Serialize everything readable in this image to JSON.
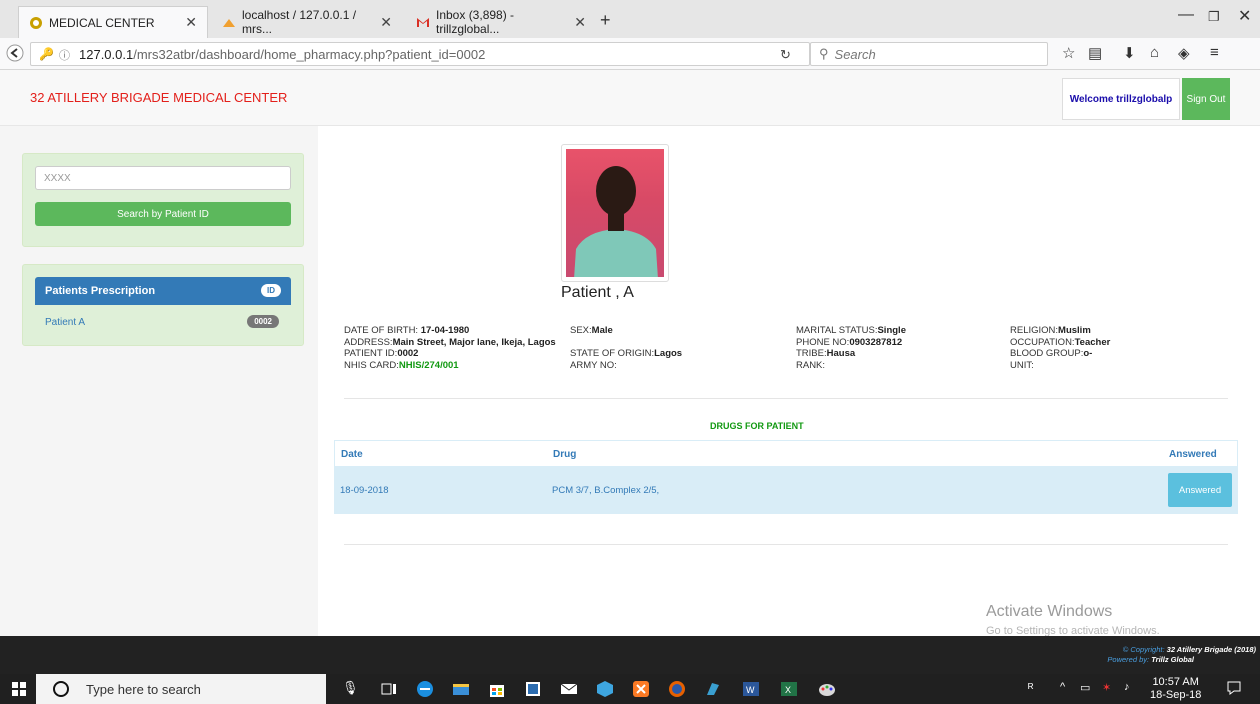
{
  "browser": {
    "tabs": [
      {
        "label": "MEDICAL CENTER",
        "active": true
      },
      {
        "label": "localhost / 127.0.0.1 / mrs...",
        "active": false
      },
      {
        "label": "Inbox (3,898) - trillzglobal...",
        "active": false
      }
    ],
    "url_host": "127.0.0.1",
    "url_path": "/mrs32atbr/dashboard/home_pharmacy.php?patient_id=0002",
    "search_placeholder": "Search"
  },
  "header": {
    "brand": "32 ATILLERY BRIGADE MEDICAL CENTER",
    "welcome": "Welcome trillzglobalp",
    "signout": "Sign Out"
  },
  "sidebar": {
    "search_placeholder": "XXXX",
    "search_button": "Search by Patient ID",
    "prescription_title": "Patients Prescription",
    "prescription_badge": "ID",
    "patients": [
      {
        "name": "Patient A",
        "id": "0002"
      }
    ]
  },
  "patient": {
    "name": "Patient , A",
    "dob_label": "DATE OF BIRTH: ",
    "dob": "17-04-1980",
    "sex_label": "SEX:",
    "sex": "Male",
    "marital_label": "MARITAL STATUS:",
    "marital": "Single",
    "religion_label": "RELIGION:",
    "religion": "Muslim",
    "address_label": "ADDRESS:",
    "address": "Main Street, Major lane, Ikeja, Lagos",
    "phone_label": "PHONE NO:",
    "phone": "0903287812",
    "occupation_label": "OCCUPATION:",
    "occupation": "Teacher",
    "pid_label": "PATIENT ID:",
    "pid": "0002",
    "state_label": "STATE OF ORIGIN:",
    "state": "Lagos",
    "tribe_label": "TRIBE:",
    "tribe": "Hausa",
    "blood_label": "BLOOD GROUP:",
    "blood": "o-",
    "nhis_label": "NHIS CARD:",
    "nhis": "NHIS/274/001",
    "army_label": "ARMY NO:",
    "rank_label": "RANK:",
    "unit_label": "UNIT:"
  },
  "drugs": {
    "title": "DRUGS FOR PATIENT",
    "columns": [
      "Date",
      "Drug",
      "Answered"
    ],
    "rows": [
      {
        "date": "18-09-2018",
        "drug": "PCM 3/7, B.Complex 2/5,",
        "status": "Answered"
      }
    ]
  },
  "watermark": {
    "line1": "Activate Windows",
    "line2": "Go to Settings to activate Windows."
  },
  "footer": {
    "copyright_prefix": "© Copyright:",
    "copyright": " 32 Atillery Brigade (2018)",
    "powered_prefix": "Powered by:",
    "powered": " Trillz Global"
  },
  "taskbar": {
    "search_placeholder": "Type here to search",
    "time": "10:57 AM",
    "date": "18-Sep-18"
  }
}
